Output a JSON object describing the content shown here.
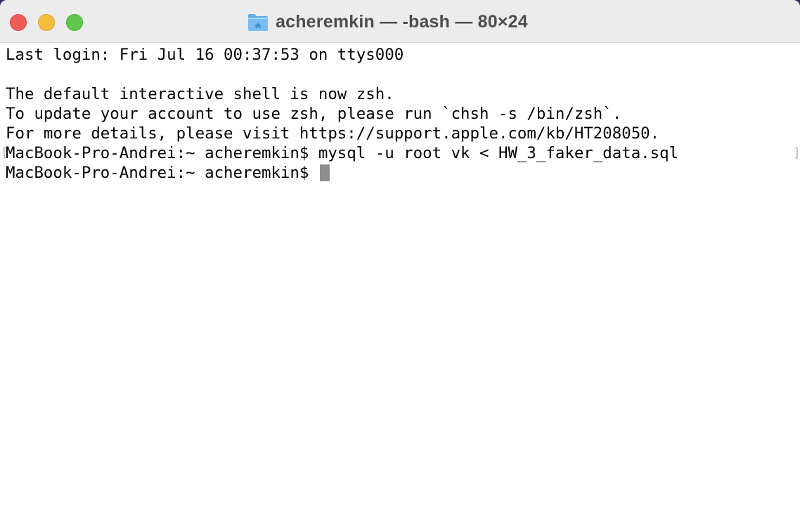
{
  "window": {
    "title": "acheremkin — -bash — 80×24",
    "folder_icon": "home-folder-icon",
    "traffic_lights": {
      "close_color": "#ee5d55",
      "minimize_color": "#f5bd3c",
      "maximize_color": "#5fc84c"
    }
  },
  "terminal": {
    "lines": [
      "Last login: Fri Jul 16 00:37:53 on ttys000",
      "",
      "The default interactive shell is now zsh.",
      "To update your account to use zsh, please run `chsh -s /bin/zsh`.",
      "For more details, please visit https://support.apple.com/kb/HT208050.",
      "MacBook-Pro-Andrei:~ acheremkin$ mysql -u root vk < HW_3_faker_data.sql",
      "MacBook-Pro-Andrei:~ acheremkin$ "
    ],
    "mark_left": "[",
    "mark_right": "]",
    "cursor_color": "#8e8e8e"
  }
}
